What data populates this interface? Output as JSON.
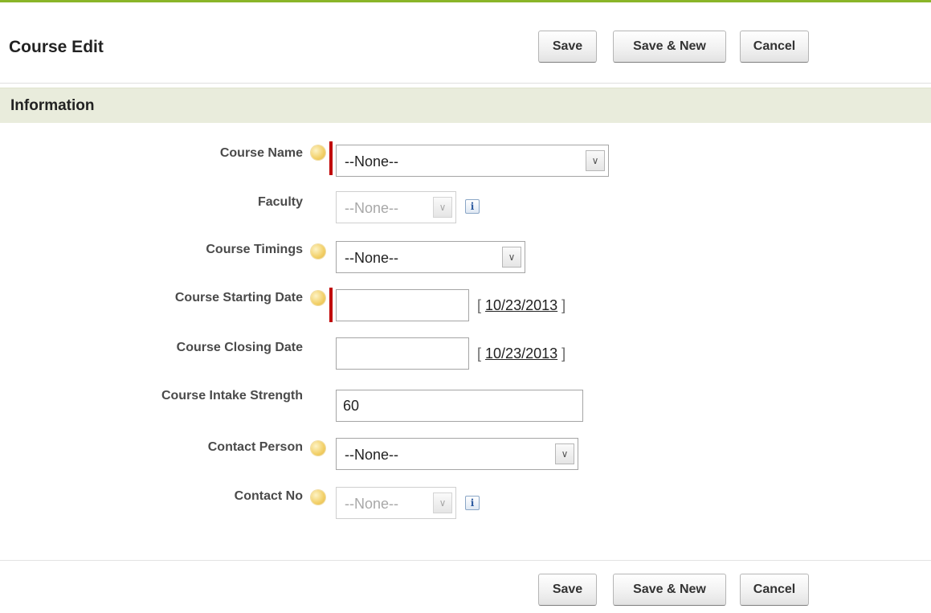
{
  "page": {
    "title": "Course Edit"
  },
  "buttons": {
    "save": "Save",
    "save_new": "Save & New",
    "cancel": "Cancel"
  },
  "section": {
    "title": "Information"
  },
  "fields": {
    "course_name": {
      "label": "Course Name",
      "value": "--None--",
      "required": true
    },
    "faculty": {
      "label": "Faculty",
      "value": "--None--",
      "disabled": true
    },
    "course_timings": {
      "label": "Course Timings",
      "value": "--None--"
    },
    "course_starting_date": {
      "label": "Course Starting Date",
      "value": "",
      "today_link": "10/23/2013",
      "required": true
    },
    "course_closing_date": {
      "label": "Course Closing Date",
      "value": "",
      "today_link": "10/23/2013"
    },
    "course_intake_strength": {
      "label": "Course Intake Strength",
      "value": "60"
    },
    "contact_person": {
      "label": "Contact Person",
      "value": "--None--"
    },
    "contact_no": {
      "label": "Contact No",
      "value": "--None--",
      "disabled": true
    }
  },
  "glyphs": {
    "dropdown_arrow": "∨",
    "info": "i",
    "bracket_open": "[",
    "bracket_close": "]"
  },
  "colors": {
    "accent_top_line": "#8ab529",
    "section_background": "#e9ecdc",
    "required_bar": "#c00000"
  },
  "icons": {
    "help": "help-bubble-icon",
    "info": "info-icon",
    "dropdown": "chevron-down-icon"
  }
}
